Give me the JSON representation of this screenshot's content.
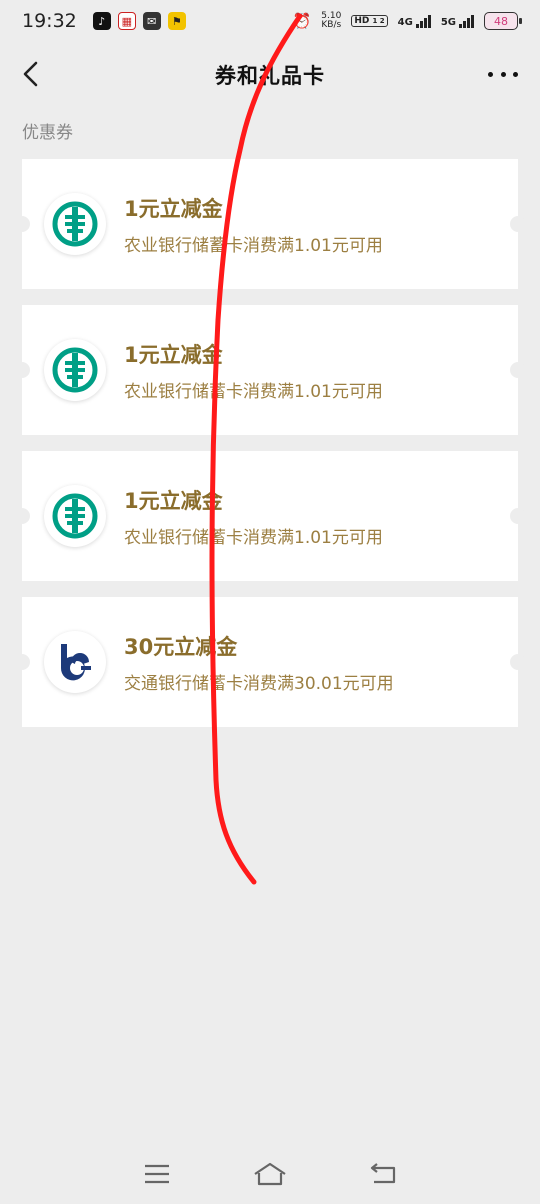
{
  "status_bar": {
    "time": "19:32",
    "speed_value": "5.10",
    "speed_unit": "KB/s",
    "hd_label": "HD",
    "hd_sub": "1 2",
    "net1": "4G",
    "net2": "5G",
    "battery": "48"
  },
  "header": {
    "title": "券和礼品卡",
    "back_icon": "chevron-left-icon",
    "more_icon": "more-dots-icon"
  },
  "section": {
    "label": "优惠券"
  },
  "coupons": [
    {
      "amount": "1元立减金",
      "desc": "农业银行储蓄卡消费满1.01元可用",
      "logo": "abc-bank-logo",
      "color": "#009f86"
    },
    {
      "amount": "1元立减金",
      "desc": "农业银行储蓄卡消费满1.01元可用",
      "logo": "abc-bank-logo",
      "color": "#009f86"
    },
    {
      "amount": "1元立减金",
      "desc": "农业银行储蓄卡消费满1.01元可用",
      "logo": "abc-bank-logo",
      "color": "#009f86"
    },
    {
      "amount": "30元立减金",
      "desc": "交通银行储蓄卡消费满30.01元可用",
      "logo": "bocom-bank-logo",
      "color": "#1d3a7a"
    }
  ],
  "nav": {
    "menu_icon": "menu-icon",
    "home_icon": "home-icon",
    "back_icon": "return-icon"
  },
  "colors": {
    "background": "#ededed",
    "amount_text": "#8a6d2c",
    "desc_text": "#9c7f42",
    "annotation": "#ff1a1a"
  }
}
